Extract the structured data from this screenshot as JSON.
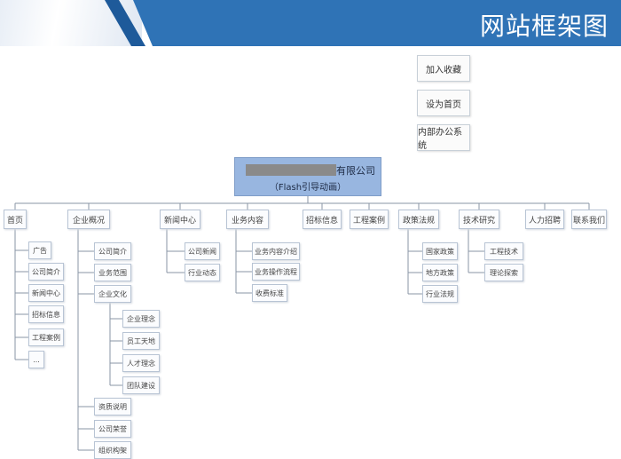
{
  "header": {
    "title": "网站框架图"
  },
  "side_actions": [
    "加入收藏",
    "设为首页",
    "内部办公系统"
  ],
  "root": {
    "line1": "有限公司",
    "line2": "（Flash引导动画）"
  },
  "top_nodes": [
    "首页",
    "企业概况",
    "新闻中心",
    "业务内容",
    "招标信息",
    "工程案例",
    "政策法规",
    "技术研究",
    "人力招聘",
    "联系我们"
  ],
  "children": {
    "home": [
      "广告",
      "公司简介",
      "新闻中心",
      "招标信息",
      "工程案例",
      "..."
    ],
    "overview": [
      "公司简介",
      "业务范围",
      "企业文化",
      "资质说明",
      "公司荣誉",
      "组织构架"
    ],
    "culture": [
      "企业理念",
      "员工天地",
      "人才理念",
      "团队建设"
    ],
    "news": [
      "公司新闻",
      "行业动态"
    ],
    "business": [
      "业务内容介绍",
      "业务操作流程",
      "收费标准"
    ],
    "policy": [
      "国家政策",
      "地方政策",
      "行业法规"
    ],
    "tech": [
      "工程技术",
      "理论探索"
    ]
  }
}
